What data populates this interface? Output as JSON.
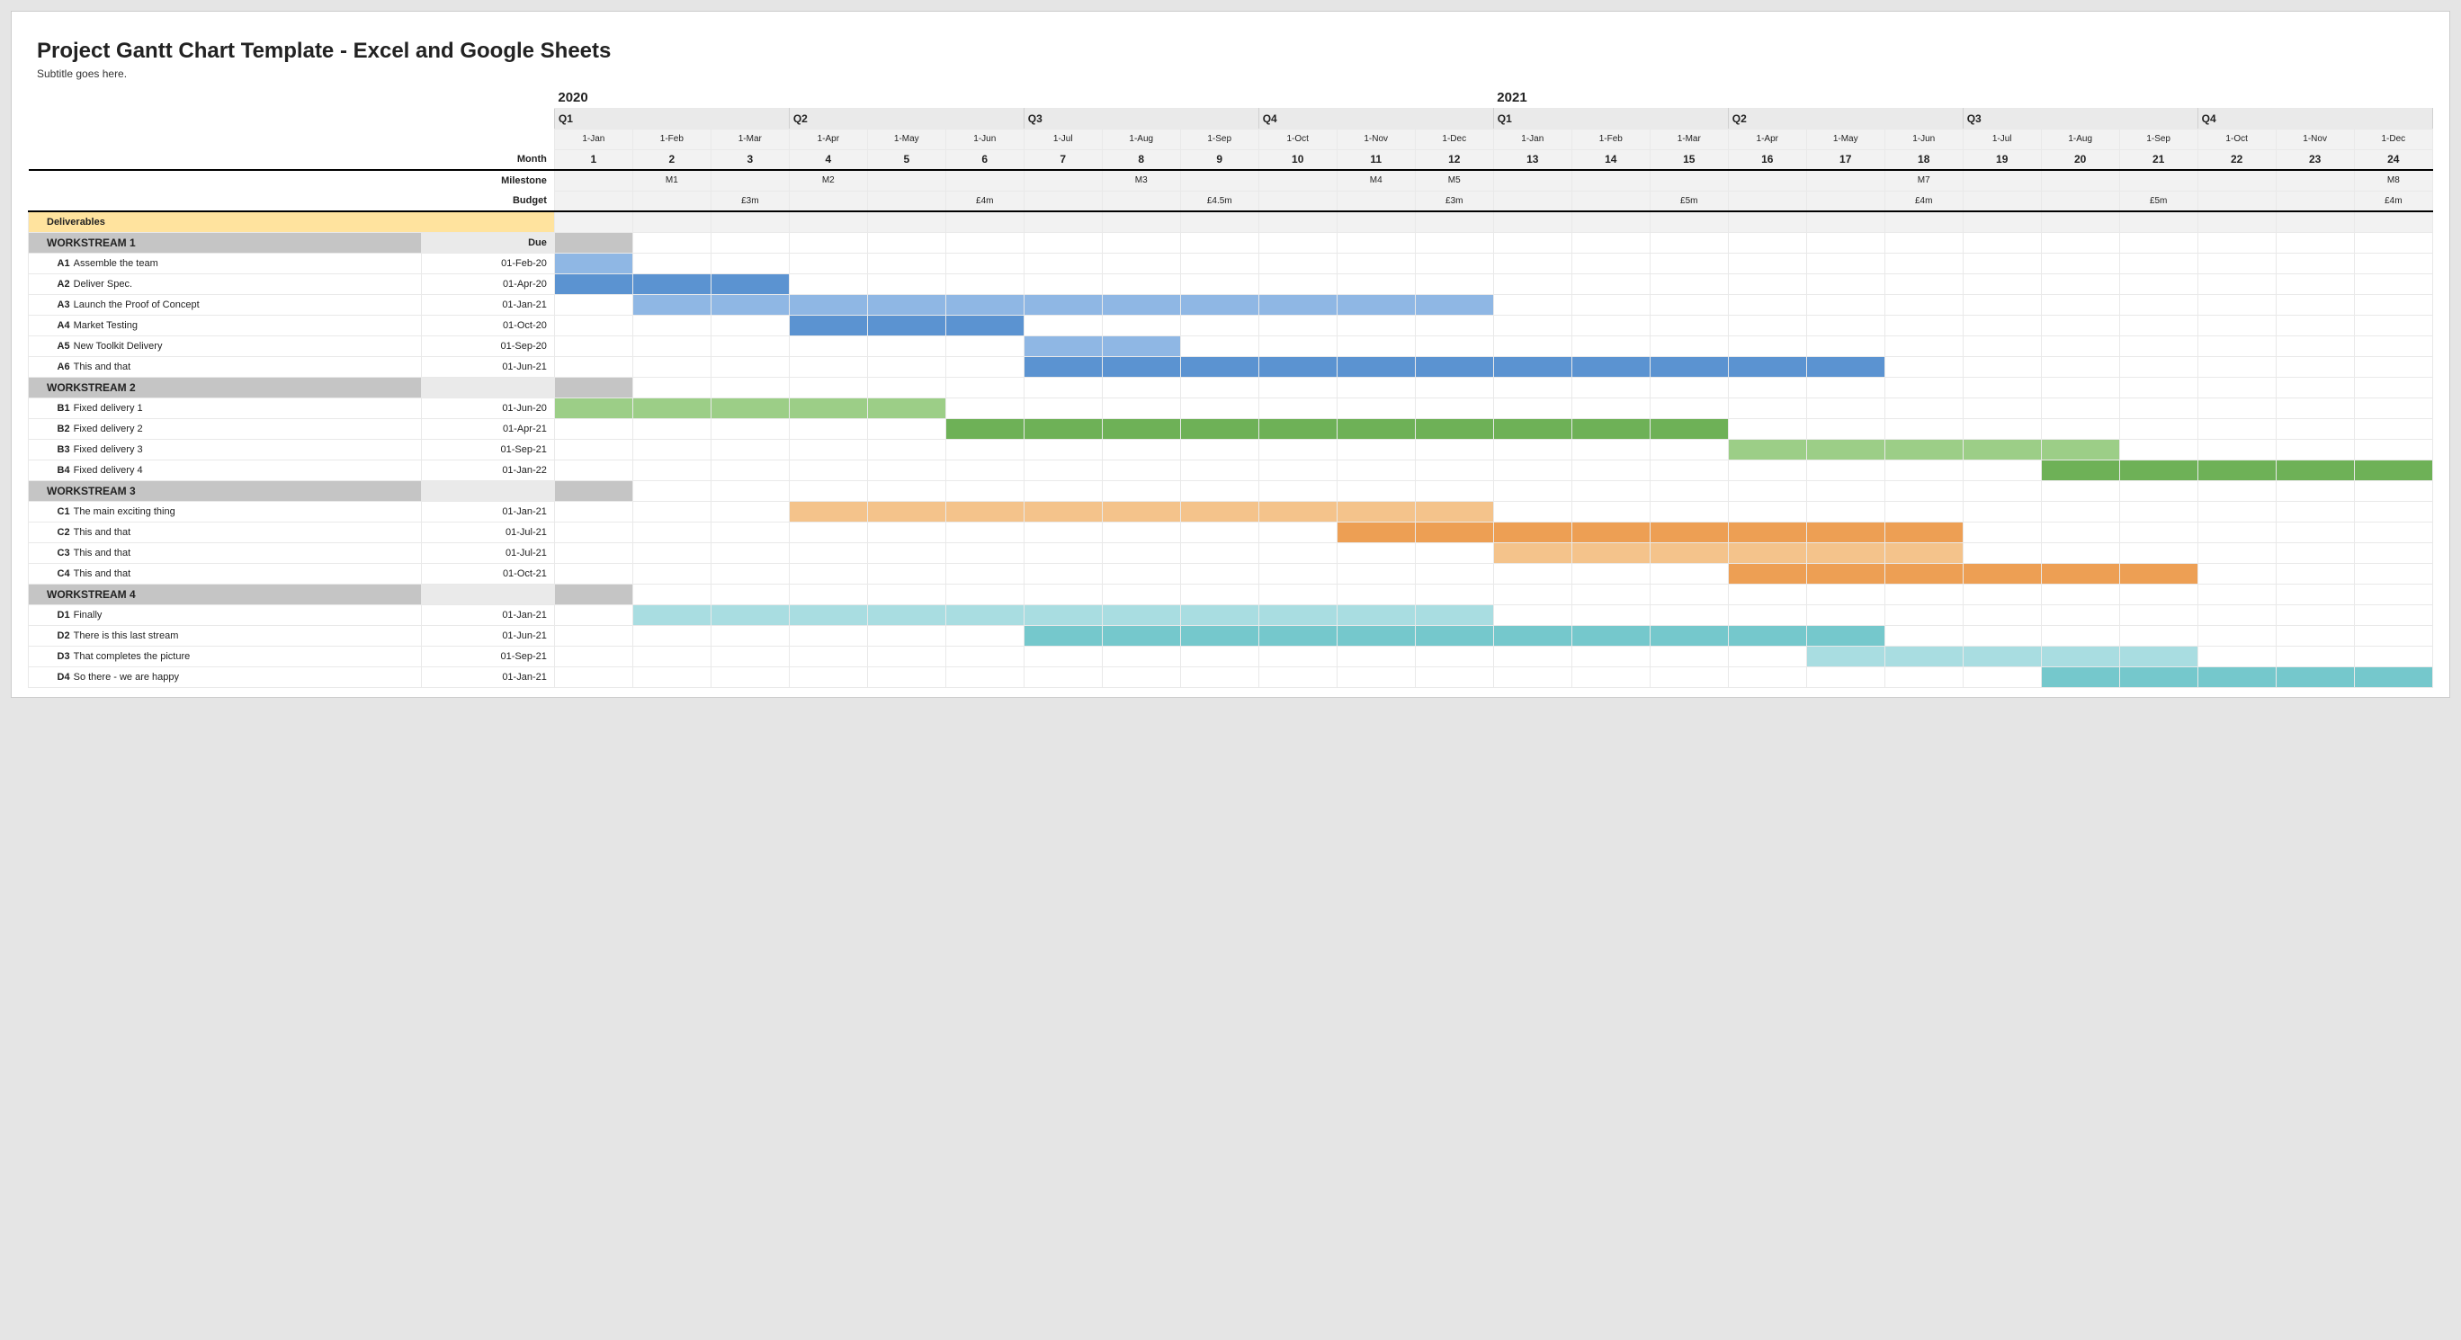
{
  "title": "Project Gantt Chart Template - Excel and Google Sheets",
  "subtitle": "Subtitle goes here.",
  "labels": {
    "month": "Month",
    "milestone": "Milestone",
    "budget": "Budget",
    "deliverables": "Deliverables",
    "due": "Due"
  },
  "years": [
    {
      "label": "2020",
      "start": 1
    },
    {
      "label": "2021",
      "start": 13
    }
  ],
  "quarters": [
    {
      "label": "Q1",
      "start": 1
    },
    {
      "label": "Q2",
      "start": 4
    },
    {
      "label": "Q3",
      "start": 7
    },
    {
      "label": "Q4",
      "start": 10
    },
    {
      "label": "Q1",
      "start": 13
    },
    {
      "label": "Q2",
      "start": 16
    },
    {
      "label": "Q3",
      "start": 19
    },
    {
      "label": "Q4",
      "start": 22
    }
  ],
  "months": [
    {
      "n": 1,
      "date": "1-Jan"
    },
    {
      "n": 2,
      "date": "1-Feb"
    },
    {
      "n": 3,
      "date": "1-Mar"
    },
    {
      "n": 4,
      "date": "1-Apr"
    },
    {
      "n": 5,
      "date": "1-May"
    },
    {
      "n": 6,
      "date": "1-Jun"
    },
    {
      "n": 7,
      "date": "1-Jul"
    },
    {
      "n": 8,
      "date": "1-Aug"
    },
    {
      "n": 9,
      "date": "1-Sep"
    },
    {
      "n": 10,
      "date": "1-Oct"
    },
    {
      "n": 11,
      "date": "1-Nov"
    },
    {
      "n": 12,
      "date": "1-Dec"
    },
    {
      "n": 13,
      "date": "1-Jan"
    },
    {
      "n": 14,
      "date": "1-Feb"
    },
    {
      "n": 15,
      "date": "1-Mar"
    },
    {
      "n": 16,
      "date": "1-Apr"
    },
    {
      "n": 17,
      "date": "1-May"
    },
    {
      "n": 18,
      "date": "1-Jun"
    },
    {
      "n": 19,
      "date": "1-Jul"
    },
    {
      "n": 20,
      "date": "1-Aug"
    },
    {
      "n": 21,
      "date": "1-Sep"
    },
    {
      "n": 22,
      "date": "1-Oct"
    },
    {
      "n": 23,
      "date": "1-Nov"
    },
    {
      "n": 24,
      "date": "1-Dec"
    }
  ],
  "milestones": {
    "2": "M1",
    "4": "M2",
    "8": "M3",
    "11": "M4",
    "12": "M5",
    "18": "M7",
    "24": "M8"
  },
  "budget": {
    "3": "£3m",
    "6": "£4m",
    "9": "£4.5m",
    "12": "£3m",
    "15": "£5m",
    "18": "£4m",
    "21": "£5m",
    "24": "£4m"
  },
  "workstreams": [
    {
      "name": "WORKSTREAM 1",
      "color_light": "c-blue-l",
      "color_dark": "c-blue-d",
      "tasks": [
        {
          "id": "A1",
          "name": "Assemble the team",
          "due": "01-Feb-20",
          "start": 1,
          "end": 1
        },
        {
          "id": "A2",
          "name": "Deliver Spec.",
          "due": "01-Apr-20",
          "start": 1,
          "end": 3
        },
        {
          "id": "A3",
          "name": "Launch the Proof of Concept",
          "due": "01-Jan-21",
          "start": 2,
          "end": 12
        },
        {
          "id": "A4",
          "name": "Market Testing",
          "due": "01-Oct-20",
          "start": 4,
          "end": 6
        },
        {
          "id": "A5",
          "name": "New Toolkit Delivery",
          "due": "01-Sep-20",
          "start": 7,
          "end": 8
        },
        {
          "id": "A6",
          "name": "This and that",
          "due": "01-Jun-21",
          "start": 7,
          "end": 17
        }
      ]
    },
    {
      "name": "WORKSTREAM 2",
      "color_light": "c-green-l",
      "color_dark": "c-green-d",
      "tasks": [
        {
          "id": "B1",
          "name": "Fixed delivery 1",
          "due": "01-Jun-20",
          "start": 1,
          "end": 5
        },
        {
          "id": "B2",
          "name": "Fixed delivery 2",
          "due": "01-Apr-21",
          "start": 6,
          "end": 15
        },
        {
          "id": "B3",
          "name": "Fixed delivery 3",
          "due": "01-Sep-21",
          "start": 16,
          "end": 20
        },
        {
          "id": "B4",
          "name": "Fixed delivery 4",
          "due": "01-Jan-22",
          "start": 20,
          "end": 24
        }
      ]
    },
    {
      "name": "WORKSTREAM 3",
      "color_light": "c-orange-l",
      "color_dark": "c-orange-d",
      "tasks": [
        {
          "id": "C1",
          "name": "The main exciting thing",
          "due": "01-Jan-21",
          "start": 4,
          "end": 12
        },
        {
          "id": "C2",
          "name": "This and that",
          "due": "01-Jul-21",
          "start": 11,
          "end": 18
        },
        {
          "id": "C3",
          "name": "This and that",
          "due": "01-Jul-21",
          "start": 13,
          "end": 18
        },
        {
          "id": "C4",
          "name": "This and that",
          "due": "01-Oct-21",
          "start": 16,
          "end": 21
        }
      ]
    },
    {
      "name": "WORKSTREAM 4",
      "color_light": "c-teal-l",
      "color_dark": "c-teal-d",
      "tasks": [
        {
          "id": "D1",
          "name": "Finally",
          "due": "01-Jan-21",
          "start": 2,
          "end": 12
        },
        {
          "id": "D2",
          "name": "There is this last stream",
          "due": "01-Jun-21",
          "start": 7,
          "end": 17
        },
        {
          "id": "D3",
          "name": "That completes the picture",
          "due": "01-Sep-21",
          "start": 17,
          "end": 21
        },
        {
          "id": "D4",
          "name": "So there - we are happy",
          "due": "01-Jan-21",
          "start": 20,
          "end": 24
        }
      ]
    }
  ],
  "chart_data": {
    "type": "gantt",
    "title": "Project Gantt Chart Template - Excel and Google Sheets",
    "x_unit": "month",
    "x_range": [
      1,
      24
    ],
    "month_labels": [
      "1-Jan",
      "1-Feb",
      "1-Mar",
      "1-Apr",
      "1-May",
      "1-Jun",
      "1-Jul",
      "1-Aug",
      "1-Sep",
      "1-Oct",
      "1-Nov",
      "1-Dec",
      "1-Jan",
      "1-Feb",
      "1-Mar",
      "1-Apr",
      "1-May",
      "1-Jun",
      "1-Jul",
      "1-Aug",
      "1-Sep",
      "1-Oct",
      "1-Nov",
      "1-Dec"
    ],
    "milestones": [
      {
        "month": 2,
        "label": "M1"
      },
      {
        "month": 4,
        "label": "M2"
      },
      {
        "month": 8,
        "label": "M3"
      },
      {
        "month": 11,
        "label": "M4"
      },
      {
        "month": 12,
        "label": "M5"
      },
      {
        "month": 18,
        "label": "M7"
      },
      {
        "month": 24,
        "label": "M8"
      }
    ],
    "budget": [
      {
        "month": 3,
        "value_gbp_m": 3
      },
      {
        "month": 6,
        "value_gbp_m": 4
      },
      {
        "month": 9,
        "value_gbp_m": 4.5
      },
      {
        "month": 12,
        "value_gbp_m": 3
      },
      {
        "month": 15,
        "value_gbp_m": 5
      },
      {
        "month": 18,
        "value_gbp_m": 4
      },
      {
        "month": 21,
        "value_gbp_m": 5
      },
      {
        "month": 24,
        "value_gbp_m": 4
      }
    ],
    "series": [
      {
        "group": "WORKSTREAM 1",
        "id": "A1",
        "name": "Assemble the team",
        "due": "01-Feb-20",
        "start": 1,
        "end": 1
      },
      {
        "group": "WORKSTREAM 1",
        "id": "A2",
        "name": "Deliver Spec.",
        "due": "01-Apr-20",
        "start": 1,
        "end": 3
      },
      {
        "group": "WORKSTREAM 1",
        "id": "A3",
        "name": "Launch the Proof of Concept",
        "due": "01-Jan-21",
        "start": 2,
        "end": 12
      },
      {
        "group": "WORKSTREAM 1",
        "id": "A4",
        "name": "Market Testing",
        "due": "01-Oct-20",
        "start": 4,
        "end": 6
      },
      {
        "group": "WORKSTREAM 1",
        "id": "A5",
        "name": "New Toolkit Delivery",
        "due": "01-Sep-20",
        "start": 7,
        "end": 8
      },
      {
        "group": "WORKSTREAM 1",
        "id": "A6",
        "name": "This and that",
        "due": "01-Jun-21",
        "start": 7,
        "end": 17
      },
      {
        "group": "WORKSTREAM 2",
        "id": "B1",
        "name": "Fixed delivery 1",
        "due": "01-Jun-20",
        "start": 1,
        "end": 5
      },
      {
        "group": "WORKSTREAM 2",
        "id": "B2",
        "name": "Fixed delivery 2",
        "due": "01-Apr-21",
        "start": 6,
        "end": 15
      },
      {
        "group": "WORKSTREAM 2",
        "id": "B3",
        "name": "Fixed delivery 3",
        "due": "01-Sep-21",
        "start": 16,
        "end": 20
      },
      {
        "group": "WORKSTREAM 2",
        "id": "B4",
        "name": "Fixed delivery 4",
        "due": "01-Jan-22",
        "start": 20,
        "end": 24
      },
      {
        "group": "WORKSTREAM 3",
        "id": "C1",
        "name": "The main exciting thing",
        "due": "01-Jan-21",
        "start": 4,
        "end": 12
      },
      {
        "group": "WORKSTREAM 3",
        "id": "C2",
        "name": "This and that",
        "due": "01-Jul-21",
        "start": 11,
        "end": 18
      },
      {
        "group": "WORKSTREAM 3",
        "id": "C3",
        "name": "This and that",
        "due": "01-Jul-21",
        "start": 13,
        "end": 18
      },
      {
        "group": "WORKSTREAM 3",
        "id": "C4",
        "name": "This and that",
        "due": "01-Oct-21",
        "start": 16,
        "end": 21
      },
      {
        "group": "WORKSTREAM 4",
        "id": "D1",
        "name": "Finally",
        "due": "01-Jan-21",
        "start": 2,
        "end": 12
      },
      {
        "group": "WORKSTREAM 4",
        "id": "D2",
        "name": "There is this last stream",
        "due": "01-Jun-21",
        "start": 7,
        "end": 17
      },
      {
        "group": "WORKSTREAM 4",
        "id": "D3",
        "name": "That completes the picture",
        "due": "01-Sep-21",
        "start": 17,
        "end": 21
      },
      {
        "group": "WORKSTREAM 4",
        "id": "D4",
        "name": "So there - we are happy",
        "due": "01-Jan-21",
        "start": 20,
        "end": 24
      }
    ]
  }
}
